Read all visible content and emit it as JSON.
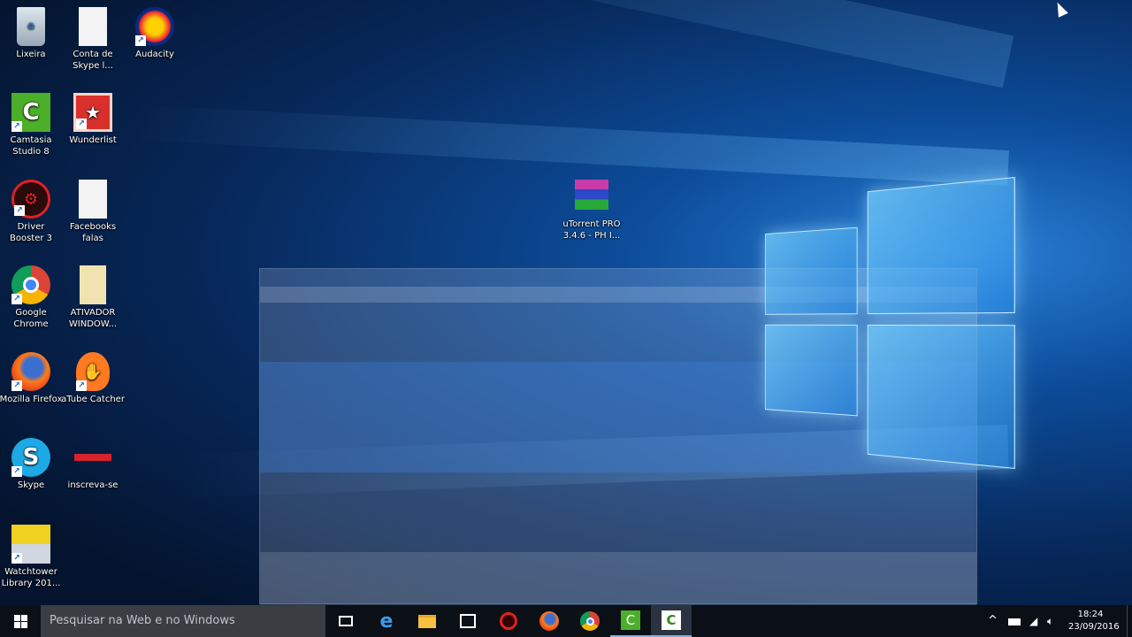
{
  "desktop": {
    "icons": [
      {
        "label": "Lixeira",
        "icon": "recycle-bin-icon"
      },
      {
        "label": "Conta de Skype l...",
        "icon": "text-document-icon"
      },
      {
        "label": "Audacity",
        "icon": "audacity-icon"
      },
      {
        "label": "Camtasia Studio 8",
        "icon": "camtasia-icon"
      },
      {
        "label": "Wunderlist",
        "icon": "wunderlist-icon"
      },
      {
        "label": "Driver Booster 3",
        "icon": "driver-booster-icon"
      },
      {
        "label": "Facebooks falas",
        "icon": "text-document-icon"
      },
      {
        "label": "Google Chrome",
        "icon": "chrome-icon"
      },
      {
        "label": "ATIVADOR WINDOW...",
        "icon": "zip-folder-icon"
      },
      {
        "label": "Mozilla Firefox",
        "icon": "firefox-icon"
      },
      {
        "label": "aTube Catcher",
        "icon": "atube-catcher-icon"
      },
      {
        "label": "Skype",
        "icon": "skype-icon"
      },
      {
        "label": "inscreva-se",
        "icon": "subscribe-image-icon"
      },
      {
        "label": "Watchtower Library 201...",
        "icon": "watchtower-library-icon"
      },
      {
        "label": "uTorrent PRO 3.4.6 - PH I...",
        "icon": "winrar-archive-icon"
      }
    ]
  },
  "taskbar": {
    "search_placeholder": "Pesquisar na Web e no Windows",
    "apps": [
      "task-view",
      "edge",
      "file-explorer",
      "store",
      "driver-booster",
      "firefox",
      "chrome",
      "camtasia",
      "camtasia-recorder"
    ],
    "time": "18:24",
    "date": "23/09/2016"
  },
  "colors": {
    "taskbar": "#0b0f16",
    "search": "#3a3d42",
    "accent": "#2a7fd6"
  }
}
